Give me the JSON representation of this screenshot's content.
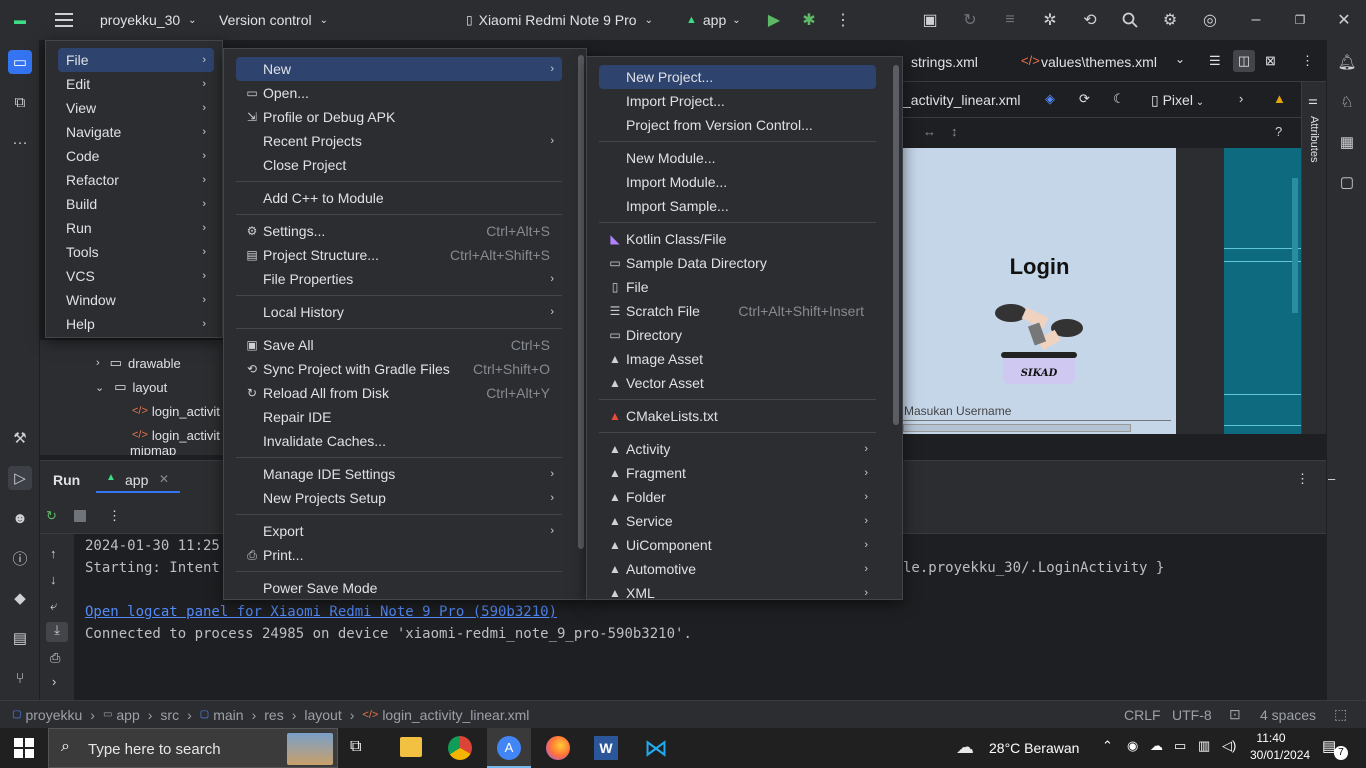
{
  "titlebar": {
    "project": "proyekku_30",
    "vcs": "Version control",
    "device": "Xiaomi Redmi Note 9 Pro",
    "run_config": "app"
  },
  "editor": {
    "tab_strings": "strings.xml",
    "tab_themes": "values\\themes.xml",
    "layout_file": "_activity_linear.xml",
    "device_preview": "Pixel",
    "attributes_label": "Attributes",
    "preview_title": "Login",
    "preview_logo_text": "SIKAD",
    "preview_hint": "Masukan Username"
  },
  "project_tree": {
    "rows": [
      {
        "label": "drawable"
      },
      {
        "label": "layout"
      },
      {
        "label": "login_activit"
      },
      {
        "label": "login_activit"
      },
      {
        "label": "mipmap"
      }
    ]
  },
  "main_menu": {
    "items": [
      {
        "label": "File"
      },
      {
        "label": "Edit"
      },
      {
        "label": "View"
      },
      {
        "label": "Navigate"
      },
      {
        "label": "Code"
      },
      {
        "label": "Refactor"
      },
      {
        "label": "Build"
      },
      {
        "label": "Run"
      },
      {
        "label": "Tools"
      },
      {
        "label": "VCS"
      },
      {
        "label": "Window"
      },
      {
        "label": "Help"
      }
    ]
  },
  "file_menu": {
    "items": [
      {
        "label": "New",
        "shortcut": ""
      },
      {
        "label": "Open...",
        "shortcut": ""
      },
      {
        "label": "Profile or Debug APK",
        "shortcut": ""
      },
      {
        "label": "Recent Projects",
        "shortcut": ""
      },
      {
        "label": "Close Project",
        "shortcut": ""
      },
      {
        "label": "Add C++ to Module",
        "shortcut": ""
      },
      {
        "label": "Settings...",
        "shortcut": "Ctrl+Alt+S"
      },
      {
        "label": "Project Structure...",
        "shortcut": "Ctrl+Alt+Shift+S"
      },
      {
        "label": "File Properties",
        "shortcut": ""
      },
      {
        "label": "Local History",
        "shortcut": ""
      },
      {
        "label": "Save All",
        "shortcut": "Ctrl+S"
      },
      {
        "label": "Sync Project with Gradle Files",
        "shortcut": "Ctrl+Shift+O"
      },
      {
        "label": "Reload All from Disk",
        "shortcut": "Ctrl+Alt+Y"
      },
      {
        "label": "Repair IDE",
        "shortcut": ""
      },
      {
        "label": "Invalidate Caches...",
        "shortcut": ""
      },
      {
        "label": "Manage IDE Settings",
        "shortcut": ""
      },
      {
        "label": "New Projects Setup",
        "shortcut": ""
      },
      {
        "label": "Export",
        "shortcut": ""
      },
      {
        "label": "Print...",
        "shortcut": ""
      },
      {
        "label": "Power Save Mode",
        "shortcut": ""
      }
    ]
  },
  "new_menu": {
    "items": [
      {
        "label": "New Project...",
        "shortcut": ""
      },
      {
        "label": "Import Project...",
        "shortcut": ""
      },
      {
        "label": "Project from Version Control...",
        "shortcut": ""
      },
      {
        "label": "New Module...",
        "shortcut": ""
      },
      {
        "label": "Import Module...",
        "shortcut": ""
      },
      {
        "label": "Import Sample...",
        "shortcut": ""
      },
      {
        "label": "Kotlin Class/File",
        "shortcut": ""
      },
      {
        "label": "Sample Data Directory",
        "shortcut": ""
      },
      {
        "label": "File",
        "shortcut": ""
      },
      {
        "label": "Scratch File",
        "shortcut": "Ctrl+Alt+Shift+Insert"
      },
      {
        "label": "Directory",
        "shortcut": ""
      },
      {
        "label": "Image Asset",
        "shortcut": ""
      },
      {
        "label": "Vector Asset",
        "shortcut": ""
      },
      {
        "label": "CMakeLists.txt",
        "shortcut": ""
      },
      {
        "label": "Activity",
        "shortcut": ""
      },
      {
        "label": "Fragment",
        "shortcut": ""
      },
      {
        "label": "Folder",
        "shortcut": ""
      },
      {
        "label": "Service",
        "shortcut": ""
      },
      {
        "label": "UiComponent",
        "shortcut": ""
      },
      {
        "label": "Automotive",
        "shortcut": ""
      },
      {
        "label": "XML",
        "shortcut": ""
      }
    ]
  },
  "run_panel": {
    "title": "Run",
    "tab": "app",
    "lines": [
      "2024-01-30 11:25:",
      "Starting: Intent",
      "le.proyekku_30/.LoginActivity }",
      "Open logcat panel for Xiaomi Redmi Note 9 Pro (590b3210)",
      "Connected to process 24985 on device 'xiaomi-redmi_note_9_pro-590b3210'."
    ]
  },
  "statusbar": {
    "breadcrumb": [
      "proyekku",
      "app",
      "src",
      "main",
      "res",
      "layout",
      "login_activity_linear.xml"
    ],
    "line_sep": "CRLF",
    "encoding": "UTF-8",
    "indent": "4 spaces"
  },
  "taskbar": {
    "search_placeholder": "Type here to search",
    "weather": "28°C  Berawan",
    "time": "11:40",
    "date": "30/01/2024",
    "notifications": "7"
  },
  "colors": {
    "accent": "#2e436e",
    "android_green": "#3ddc84",
    "link": "#548af7"
  }
}
